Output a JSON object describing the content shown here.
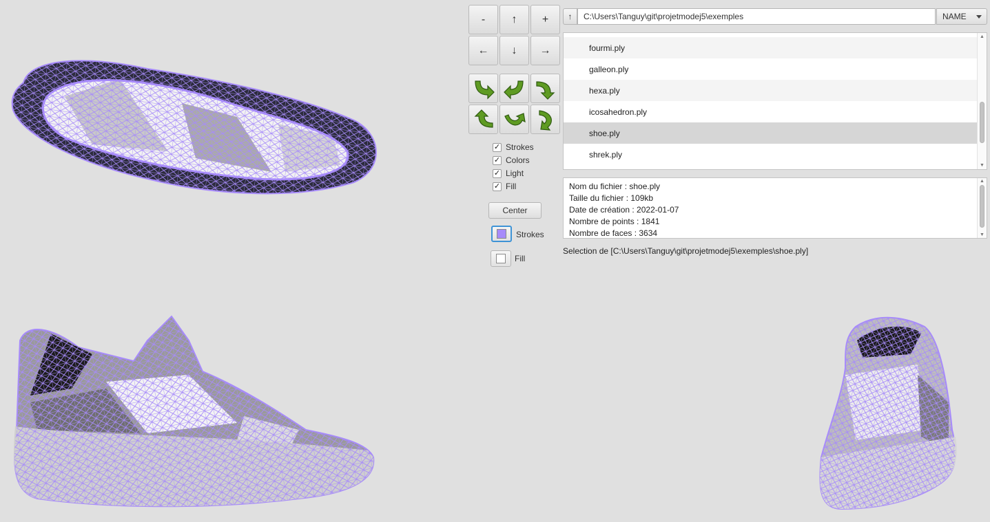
{
  "controls": {
    "zoom_out": "-",
    "move_up": "↑",
    "zoom_in": "+",
    "move_left": "←",
    "move_down": "↓",
    "move_right": "→",
    "checkboxes": [
      {
        "label": "Strokes",
        "checked": true
      },
      {
        "label": "Colors",
        "checked": true
      },
      {
        "label": "Light",
        "checked": true
      },
      {
        "label": "Fill",
        "checked": true
      }
    ],
    "check_mark": "✓",
    "center_label": "Center",
    "strokes_color_label": "Strokes",
    "fill_color_label": "Fill",
    "strokes_color": "#a78bfa",
    "fill_color": "#ffffff"
  },
  "browser": {
    "up_label": "↑",
    "path": "C:\\Users\\Tanguy\\git\\projetmodej5\\exemples",
    "sort_label": "NAME",
    "files": [
      {
        "name": "fourmi.ply"
      },
      {
        "name": "galleon.ply"
      },
      {
        "name": "hexa.ply"
      },
      {
        "name": "icosahedron.ply"
      },
      {
        "name": "shoe.ply",
        "selected": true
      },
      {
        "name": "shrek.ply"
      }
    ]
  },
  "info": {
    "lines": [
      "Nom du fichier : shoe.ply",
      "Taille du fichier : 109kb",
      "Date de création : 2022-01-07",
      "Nombre de points : 1841",
      "Nombre de faces : 3634"
    ]
  },
  "status": "Selection de [C:\\Users\\Tanguy\\git\\projetmodej5\\exemples\\shoe.ply]",
  "theme": {
    "mesh_stroke": "#a78bfa",
    "background": "#e0e0e0",
    "selection": "#d6d6d6"
  }
}
